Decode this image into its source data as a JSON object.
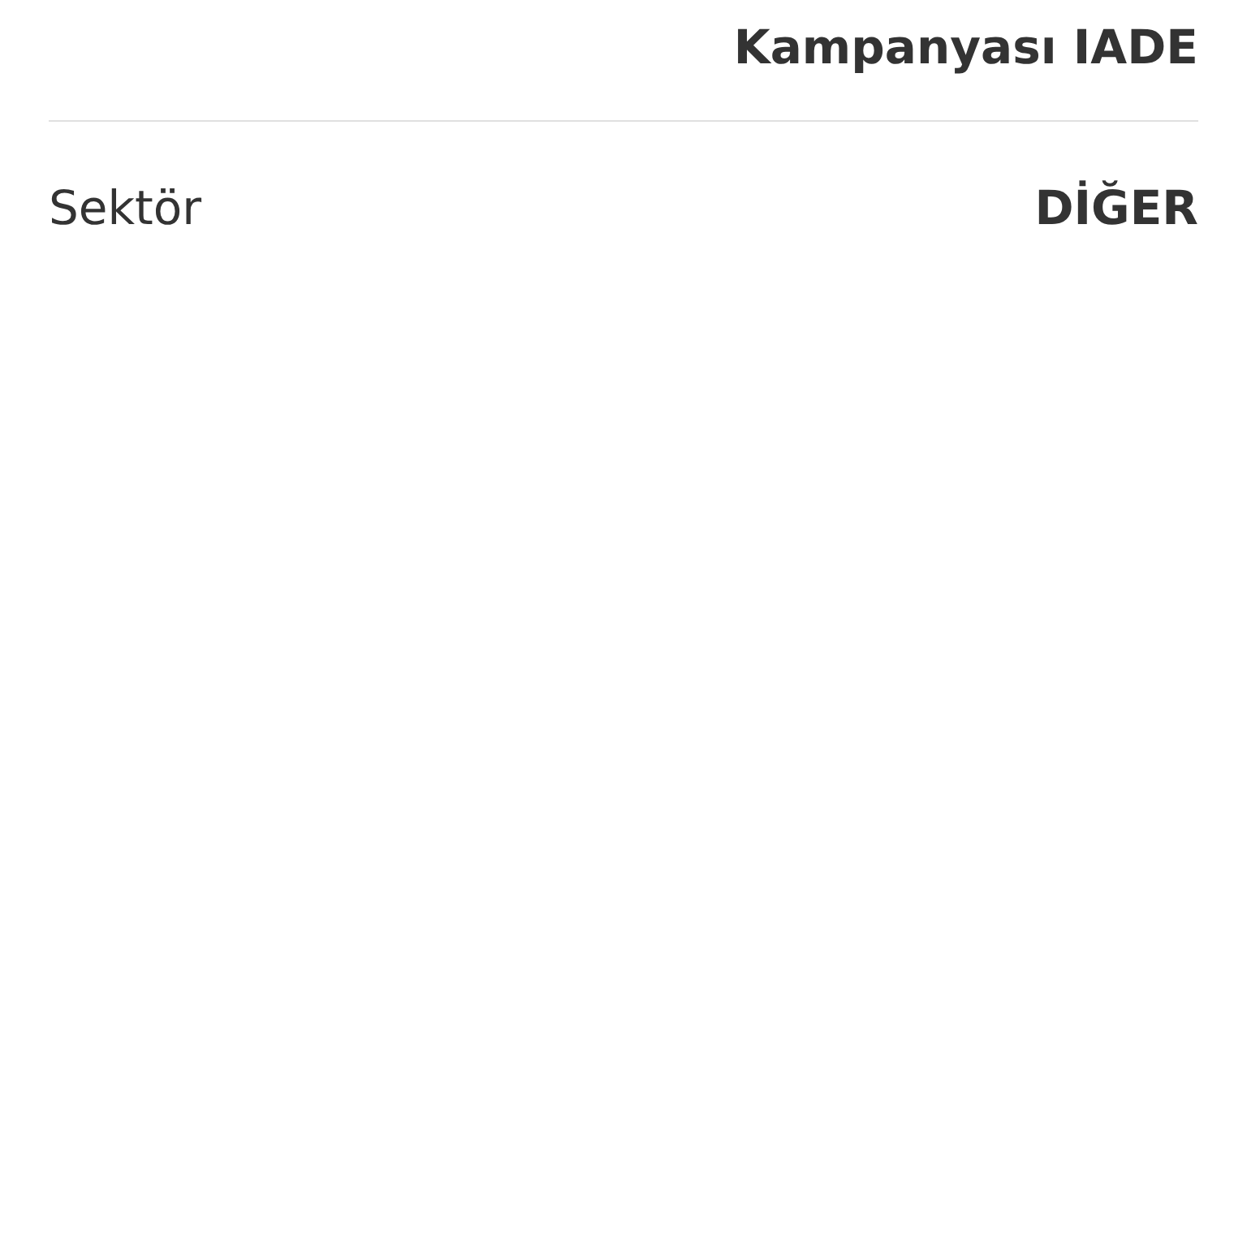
{
  "rows": [
    {
      "value": "Kampanyası IADE"
    },
    {
      "label": "Sektör",
      "value": "DİĞER"
    }
  ]
}
